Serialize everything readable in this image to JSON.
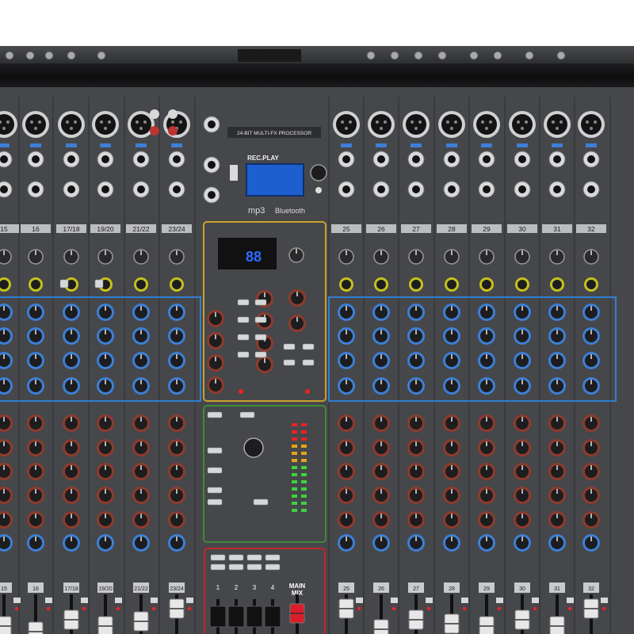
{
  "fx_processor": {
    "title": "24-BIT MULTI-FX PROCESSOR",
    "brand": "REC.PLAY",
    "mp3": "mp3",
    "bluetooth": "Bluetooth"
  },
  "channels_left": [
    "15",
    "16",
    "17/18",
    "19/20",
    "21/22",
    "23/24"
  ],
  "channels_right": [
    "25",
    "26",
    "27",
    "28",
    "29",
    "30",
    "31",
    "32"
  ],
  "master": {
    "main_mix_label": "MAIN\nMIX",
    "group_labels": [
      "1",
      "2",
      "3",
      "4"
    ],
    "fx_display": "88"
  },
  "colors": {
    "panel": "#46474a",
    "eq_outline": "#2f7fd1",
    "fx_outline": "#c9a22a",
    "aux_outline": "#3f8a3a",
    "group_outline": "#c0262b",
    "knob_blue": "#3d7fd6",
    "knob_red": "#8e3b2c",
    "knob_yellow": "#c4c21c",
    "fader_red": "#d91e2a"
  }
}
